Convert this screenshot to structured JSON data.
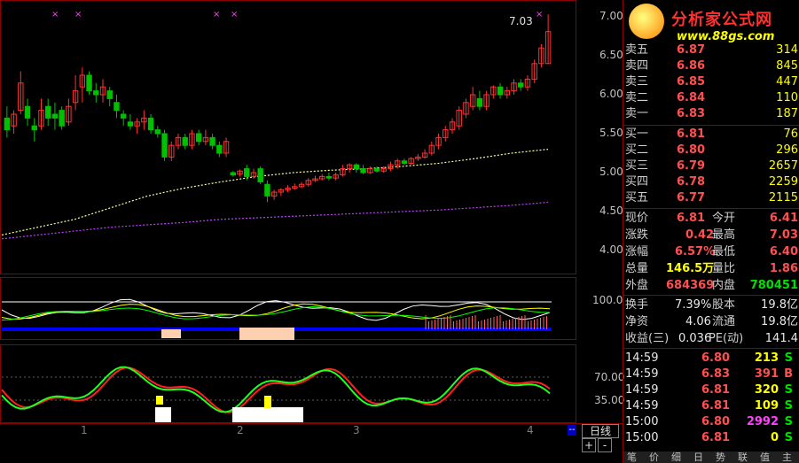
{
  "chart": {
    "price_labels": [
      "7.00",
      "6.50",
      "6.00",
      "5.50",
      "5.00",
      "4.50",
      "4.00"
    ],
    "peak_label": "7.03",
    "ind1_label": "100.0",
    "ind2_labels": [
      "70.00",
      "35.00"
    ],
    "time_ticks": [
      "1",
      "2",
      "3",
      "4"
    ],
    "period_label": "日线",
    "plus_label": "+",
    "minus_label": "-",
    "candles": [
      {
        "o": 5.7,
        "c": 5.55,
        "h": 5.85,
        "l": 5.45
      },
      {
        "o": 5.6,
        "c": 5.75,
        "h": 5.8,
        "l": 5.5
      },
      {
        "o": 5.8,
        "c": 6.15,
        "h": 6.3,
        "l": 5.75
      },
      {
        "o": 5.85,
        "c": 5.7,
        "h": 5.95,
        "l": 5.6
      },
      {
        "o": 5.6,
        "c": 5.55,
        "h": 5.7,
        "l": 5.4
      },
      {
        "o": 5.6,
        "c": 5.8,
        "h": 5.95,
        "l": 5.55
      },
      {
        "o": 5.85,
        "c": 5.7,
        "h": 5.95,
        "l": 5.6
      },
      {
        "o": 5.75,
        "c": 5.7,
        "h": 5.9,
        "l": 5.55
      },
      {
        "o": 5.8,
        "c": 5.6,
        "h": 5.85,
        "l": 5.55
      },
      {
        "o": 5.65,
        "c": 5.85,
        "h": 5.95,
        "l": 5.6
      },
      {
        "o": 5.9,
        "c": 6.05,
        "h": 6.25,
        "l": 5.8
      },
      {
        "o": 6.1,
        "c": 6.25,
        "h": 6.35,
        "l": 5.9
      },
      {
        "o": 6.25,
        "c": 6.05,
        "h": 6.3,
        "l": 6.0
      },
      {
        "o": 6.05,
        "c": 6.0,
        "h": 6.15,
        "l": 5.9
      },
      {
        "o": 6.0,
        "c": 6.1,
        "h": 6.2,
        "l": 5.9
      },
      {
        "o": 6.05,
        "c": 5.95,
        "h": 6.1,
        "l": 5.85
      },
      {
        "o": 5.9,
        "c": 5.8,
        "h": 6.0,
        "l": 5.7
      },
      {
        "o": 5.75,
        "c": 5.7,
        "h": 5.8,
        "l": 5.6
      },
      {
        "o": 5.65,
        "c": 5.6,
        "h": 5.75,
        "l": 5.55
      },
      {
        "o": 5.6,
        "c": 5.65,
        "h": 5.7,
        "l": 5.5
      },
      {
        "o": 5.65,
        "c": 5.7,
        "h": 5.8,
        "l": 5.55
      },
      {
        "o": 5.7,
        "c": 5.55,
        "h": 5.75,
        "l": 5.5
      },
      {
        "o": 5.55,
        "c": 5.5,
        "h": 5.6,
        "l": 5.45
      },
      {
        "o": 5.5,
        "c": 5.2,
        "h": 5.55,
        "l": 5.15
      },
      {
        "o": 5.2,
        "c": 5.35,
        "h": 5.4,
        "l": 5.15
      },
      {
        "o": 5.35,
        "c": 5.45,
        "h": 5.5,
        "l": 5.3
      },
      {
        "o": 5.45,
        "c": 5.35,
        "h": 5.5,
        "l": 5.3
      },
      {
        "o": 5.35,
        "c": 5.5,
        "h": 5.55,
        "l": 5.3
      },
      {
        "o": 5.5,
        "c": 5.4,
        "h": 5.55,
        "l": 5.35
      },
      {
        "o": 5.4,
        "c": 5.45,
        "h": 5.55,
        "l": 5.35
      },
      {
        "o": 5.45,
        "c": 5.35,
        "h": 5.5,
        "l": 5.3
      },
      {
        "o": 5.35,
        "c": 5.25,
        "h": 5.4,
        "l": 5.2
      },
      {
        "o": 5.25,
        "c": 5.4,
        "h": 5.45,
        "l": 5.2
      },
      {
        "o": 5.0,
        "c": 4.97,
        "h": 5.02,
        "l": 4.95
      },
      {
        "o": 4.98,
        "c": 5.02,
        "h": 5.04,
        "l": 4.95
      },
      {
        "o": 5.05,
        "c": 4.95,
        "h": 5.1,
        "l": 4.9
      },
      {
        "o": 4.95,
        "c": 5.0,
        "h": 5.05,
        "l": 4.92
      },
      {
        "o": 5.05,
        "c": 4.88,
        "h": 5.08,
        "l": 4.85
      },
      {
        "o": 4.85,
        "c": 4.7,
        "h": 4.9,
        "l": 4.62
      },
      {
        "o": 4.7,
        "c": 4.75,
        "h": 4.78,
        "l": 4.65
      },
      {
        "o": 4.75,
        "c": 4.78,
        "h": 4.8,
        "l": 4.7
      },
      {
        "o": 4.78,
        "c": 4.8,
        "h": 4.84,
        "l": 4.75
      },
      {
        "o": 4.8,
        "c": 4.82,
        "h": 4.86,
        "l": 4.78
      },
      {
        "o": 4.82,
        "c": 4.85,
        "h": 4.88,
        "l": 4.8
      },
      {
        "o": 4.85,
        "c": 4.9,
        "h": 4.93,
        "l": 4.82
      },
      {
        "o": 4.9,
        "c": 4.92,
        "h": 4.96,
        "l": 4.88
      },
      {
        "o": 4.92,
        "c": 4.95,
        "h": 4.98,
        "l": 4.9
      },
      {
        "o": 4.95,
        "c": 4.93,
        "h": 5.0,
        "l": 4.9
      },
      {
        "o": 4.93,
        "c": 4.97,
        "h": 5.0,
        "l": 4.9
      },
      {
        "o": 4.97,
        "c": 5.05,
        "h": 5.1,
        "l": 4.95
      },
      {
        "o": 5.05,
        "c": 5.1,
        "h": 5.12,
        "l": 5.0
      },
      {
        "o": 5.1,
        "c": 5.05,
        "h": 5.12,
        "l": 5.0
      },
      {
        "o": 5.05,
        "c": 5.0,
        "h": 5.1,
        "l": 4.98
      },
      {
        "o": 5.0,
        "c": 5.05,
        "h": 5.08,
        "l": 4.98
      },
      {
        "o": 5.05,
        "c": 5.02,
        "h": 5.08,
        "l": 5.0
      },
      {
        "o": 5.02,
        "c": 5.05,
        "h": 5.08,
        "l": 5.0
      },
      {
        "o": 5.05,
        "c": 5.1,
        "h": 5.14,
        "l": 5.02
      },
      {
        "o": 5.1,
        "c": 5.15,
        "h": 5.18,
        "l": 5.05
      },
      {
        "o": 5.15,
        "c": 5.12,
        "h": 5.18,
        "l": 5.1
      },
      {
        "o": 5.12,
        "c": 5.18,
        "h": 5.2,
        "l": 5.1
      },
      {
        "o": 5.18,
        "c": 5.2,
        "h": 5.24,
        "l": 5.15
      },
      {
        "o": 5.2,
        "c": 5.25,
        "h": 5.3,
        "l": 5.18
      },
      {
        "o": 5.25,
        "c": 5.35,
        "h": 5.4,
        "l": 5.22
      },
      {
        "o": 5.35,
        "c": 5.45,
        "h": 5.5,
        "l": 5.3
      },
      {
        "o": 5.45,
        "c": 5.55,
        "h": 5.6,
        "l": 5.4
      },
      {
        "o": 5.55,
        "c": 5.65,
        "h": 5.7,
        "l": 5.5
      },
      {
        "o": 5.6,
        "c": 5.8,
        "h": 5.85,
        "l": 5.55
      },
      {
        "o": 5.75,
        "c": 5.9,
        "h": 5.95,
        "l": 5.7
      },
      {
        "o": 5.85,
        "c": 6.0,
        "h": 6.1,
        "l": 5.8
      },
      {
        "o": 5.95,
        "c": 5.85,
        "h": 6.05,
        "l": 5.8
      },
      {
        "o": 5.85,
        "c": 6.0,
        "h": 6.05,
        "l": 5.8
      },
      {
        "o": 6.0,
        "c": 6.1,
        "h": 6.12,
        "l": 5.95
      },
      {
        "o": 6.1,
        "c": 6.0,
        "h": 6.15,
        "l": 5.95
      },
      {
        "o": 6.0,
        "c": 6.05,
        "h": 6.1,
        "l": 5.95
      },
      {
        "o": 6.05,
        "c": 6.15,
        "h": 6.2,
        "l": 6.0
      },
      {
        "o": 6.15,
        "c": 6.1,
        "h": 6.2,
        "l": 6.05
      },
      {
        "o": 6.1,
        "c": 6.2,
        "h": 6.25,
        "l": 6.05
      },
      {
        "o": 6.2,
        "c": 6.4,
        "h": 6.45,
        "l": 6.15
      },
      {
        "o": 6.4,
        "c": 6.6,
        "h": 6.65,
        "l": 6.35
      },
      {
        "o": 6.4,
        "c": 6.81,
        "h": 7.03,
        "l": 6.4
      }
    ],
    "ma_white": [
      4.2,
      4.3,
      4.4,
      4.55,
      4.7,
      4.8,
      4.88,
      4.95,
      5.0,
      5.03,
      5.05,
      5.08,
      5.12,
      5.18,
      5.25,
      5.3
    ],
    "ma_magenta": [
      4.15,
      4.2,
      4.25,
      4.3,
      4.33,
      4.36,
      4.4,
      4.42,
      4.44,
      4.46,
      4.48,
      4.5,
      4.52,
      4.55,
      4.58,
      4.62
    ]
  },
  "logo": {
    "title": "分析家公式网",
    "url": "www.88gs.com"
  },
  "orderbook": {
    "asks": [
      {
        "label": "卖五",
        "price": "6.87",
        "vol": "314"
      },
      {
        "label": "卖四",
        "price": "6.86",
        "vol": "845"
      },
      {
        "label": "卖三",
        "price": "6.85",
        "vol": "447"
      },
      {
        "label": "卖二",
        "price": "6.84",
        "vol": "110"
      },
      {
        "label": "卖一",
        "price": "6.83",
        "vol": "187"
      }
    ],
    "bids": [
      {
        "label": "买一",
        "price": "6.81",
        "vol": "76"
      },
      {
        "label": "买二",
        "price": "6.80",
        "vol": "296"
      },
      {
        "label": "买三",
        "price": "6.79",
        "vol": "2657"
      },
      {
        "label": "买四",
        "price": "6.78",
        "vol": "2259"
      },
      {
        "label": "买五",
        "price": "6.77",
        "vol": "2115"
      }
    ]
  },
  "stats": {
    "xianjia_label": "现价",
    "xianjia": "6.81",
    "jinkai_label": "今开",
    "jinkai": "6.41",
    "zhangdie_label": "涨跌",
    "zhangdie": "0.42",
    "zuigao_label": "最高",
    "zuigao": "7.03",
    "zhangfu_label": "涨幅",
    "zhangfu": "6.57%",
    "zuidi_label": "最低",
    "zuidi": "6.40",
    "zongliang_label": "总量",
    "zongliang": "146.5万",
    "liangbi_label": "量比",
    "liangbi": "1.86",
    "waipan_label": "外盘",
    "waipan": "684369",
    "neipan_label": "内盘",
    "neipan": "780451",
    "huanshou_label": "换手",
    "huanshou": "7.39%",
    "guben_label": "股本",
    "guben": "19.8亿",
    "jingzi_label": "净资",
    "jingzi": "4.06",
    "liutong_label": "流通",
    "liutong": "19.8亿",
    "shouyi_label": "收益(三)",
    "shouyi": "0.036",
    "pe_label": "PE(动)",
    "pe": "141.4"
  },
  "ticks": [
    {
      "time": "14:59",
      "price": "6.80",
      "vol": "213",
      "side": "S"
    },
    {
      "time": "14:59",
      "price": "6.83",
      "vol": "391",
      "side": "B"
    },
    {
      "time": "14:59",
      "price": "6.81",
      "vol": "320",
      "side": "S"
    },
    {
      "time": "14:59",
      "price": "6.81",
      "vol": "109",
      "side": "S"
    },
    {
      "time": "15:00",
      "price": "6.80",
      "vol": "2992",
      "side": "S"
    },
    {
      "time": "15:00",
      "price": "6.81",
      "vol": "0",
      "side": "S"
    }
  ],
  "tabs": [
    "笔",
    "价",
    "细",
    "日",
    "势",
    "联",
    "值",
    "主"
  ],
  "colors": {
    "up": "#ff3232",
    "down": "#00c000",
    "grid": "#8b0000"
  }
}
